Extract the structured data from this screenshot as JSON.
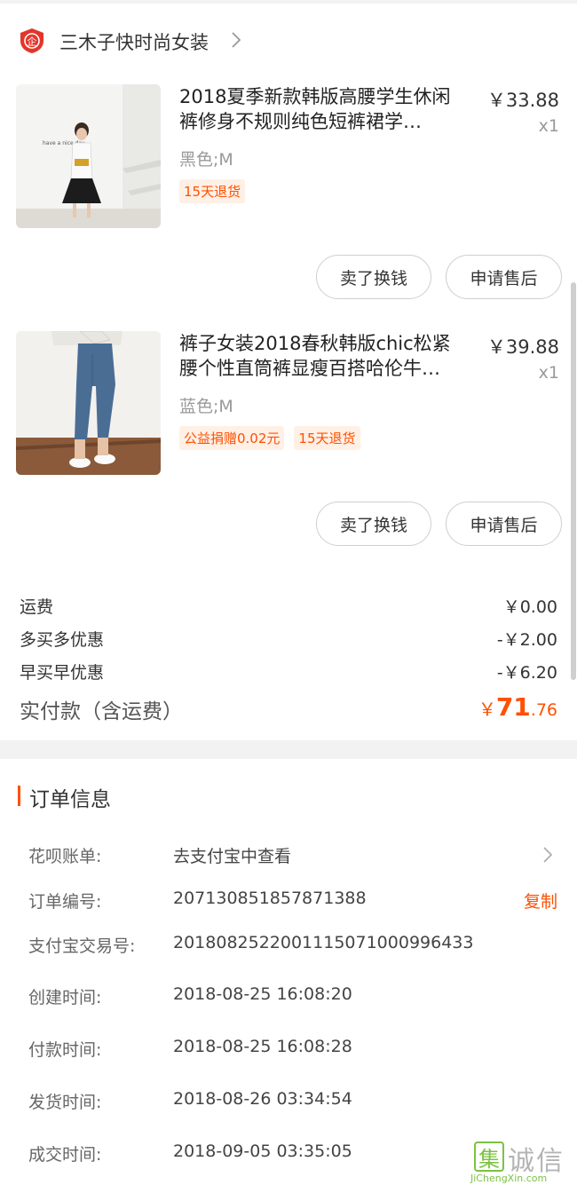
{
  "shop": {
    "name": "三木子快时尚女装",
    "logo_char": "企"
  },
  "items": [
    {
      "title": "2018夏季新款韩版高腰学生休闲裤修身不规则纯色短裤裙学…",
      "price": "￥33.88",
      "qty": "x1",
      "spec": "黑色;M",
      "tags": [
        "15天退货"
      ],
      "thumb_text": "have a nice day",
      "btn_sell": "卖了换钱",
      "btn_after": "申请售后"
    },
    {
      "title": "裤子女装2018春秋韩版chic松紧腰个性直筒裤显瘦百搭哈伦牛…",
      "price": "￥39.88",
      "qty": "x1",
      "spec": "蓝色;M",
      "tags": [
        "公益捐赠0.02元",
        "15天退货"
      ],
      "btn_sell": "卖了换钱",
      "btn_after": "申请售后"
    }
  ],
  "fees": [
    {
      "label": "运费",
      "value": "￥0.00"
    },
    {
      "label": "多买多优惠",
      "value": "-￥2.00"
    },
    {
      "label": "早买早优惠",
      "value": "-￥6.20"
    }
  ],
  "total": {
    "label": "实付款（含运费）",
    "currency": "￥",
    "int": "71",
    "dec": ".76"
  },
  "order_info": {
    "title": "订单信息",
    "rows": [
      {
        "key": "花呗账单:",
        "value": "去支付宝中查看"
      },
      {
        "key": "订单编号:",
        "value": "207130851857871388",
        "action": "复制"
      },
      {
        "key": "支付宝交易号:",
        "value": "2018082522001115071000996433"
      },
      {
        "key": "创建时间:",
        "value": "2018-08-25 16:08:20"
      },
      {
        "key": "付款时间:",
        "value": "2018-08-25 16:08:28"
      },
      {
        "key": "发货时间:",
        "value": "2018-08-26 03:34:54"
      },
      {
        "key": "成交时间:",
        "value": "2018-09-05 03:35:05"
      }
    ]
  },
  "watermark": {
    "box_char": "集",
    "text": "诚信",
    "url": "JiChengXin.com"
  },
  "colors": {
    "accent": "#ff5000",
    "tag_bg": "#fff0e6",
    "watermark_green": "#7cc242"
  }
}
